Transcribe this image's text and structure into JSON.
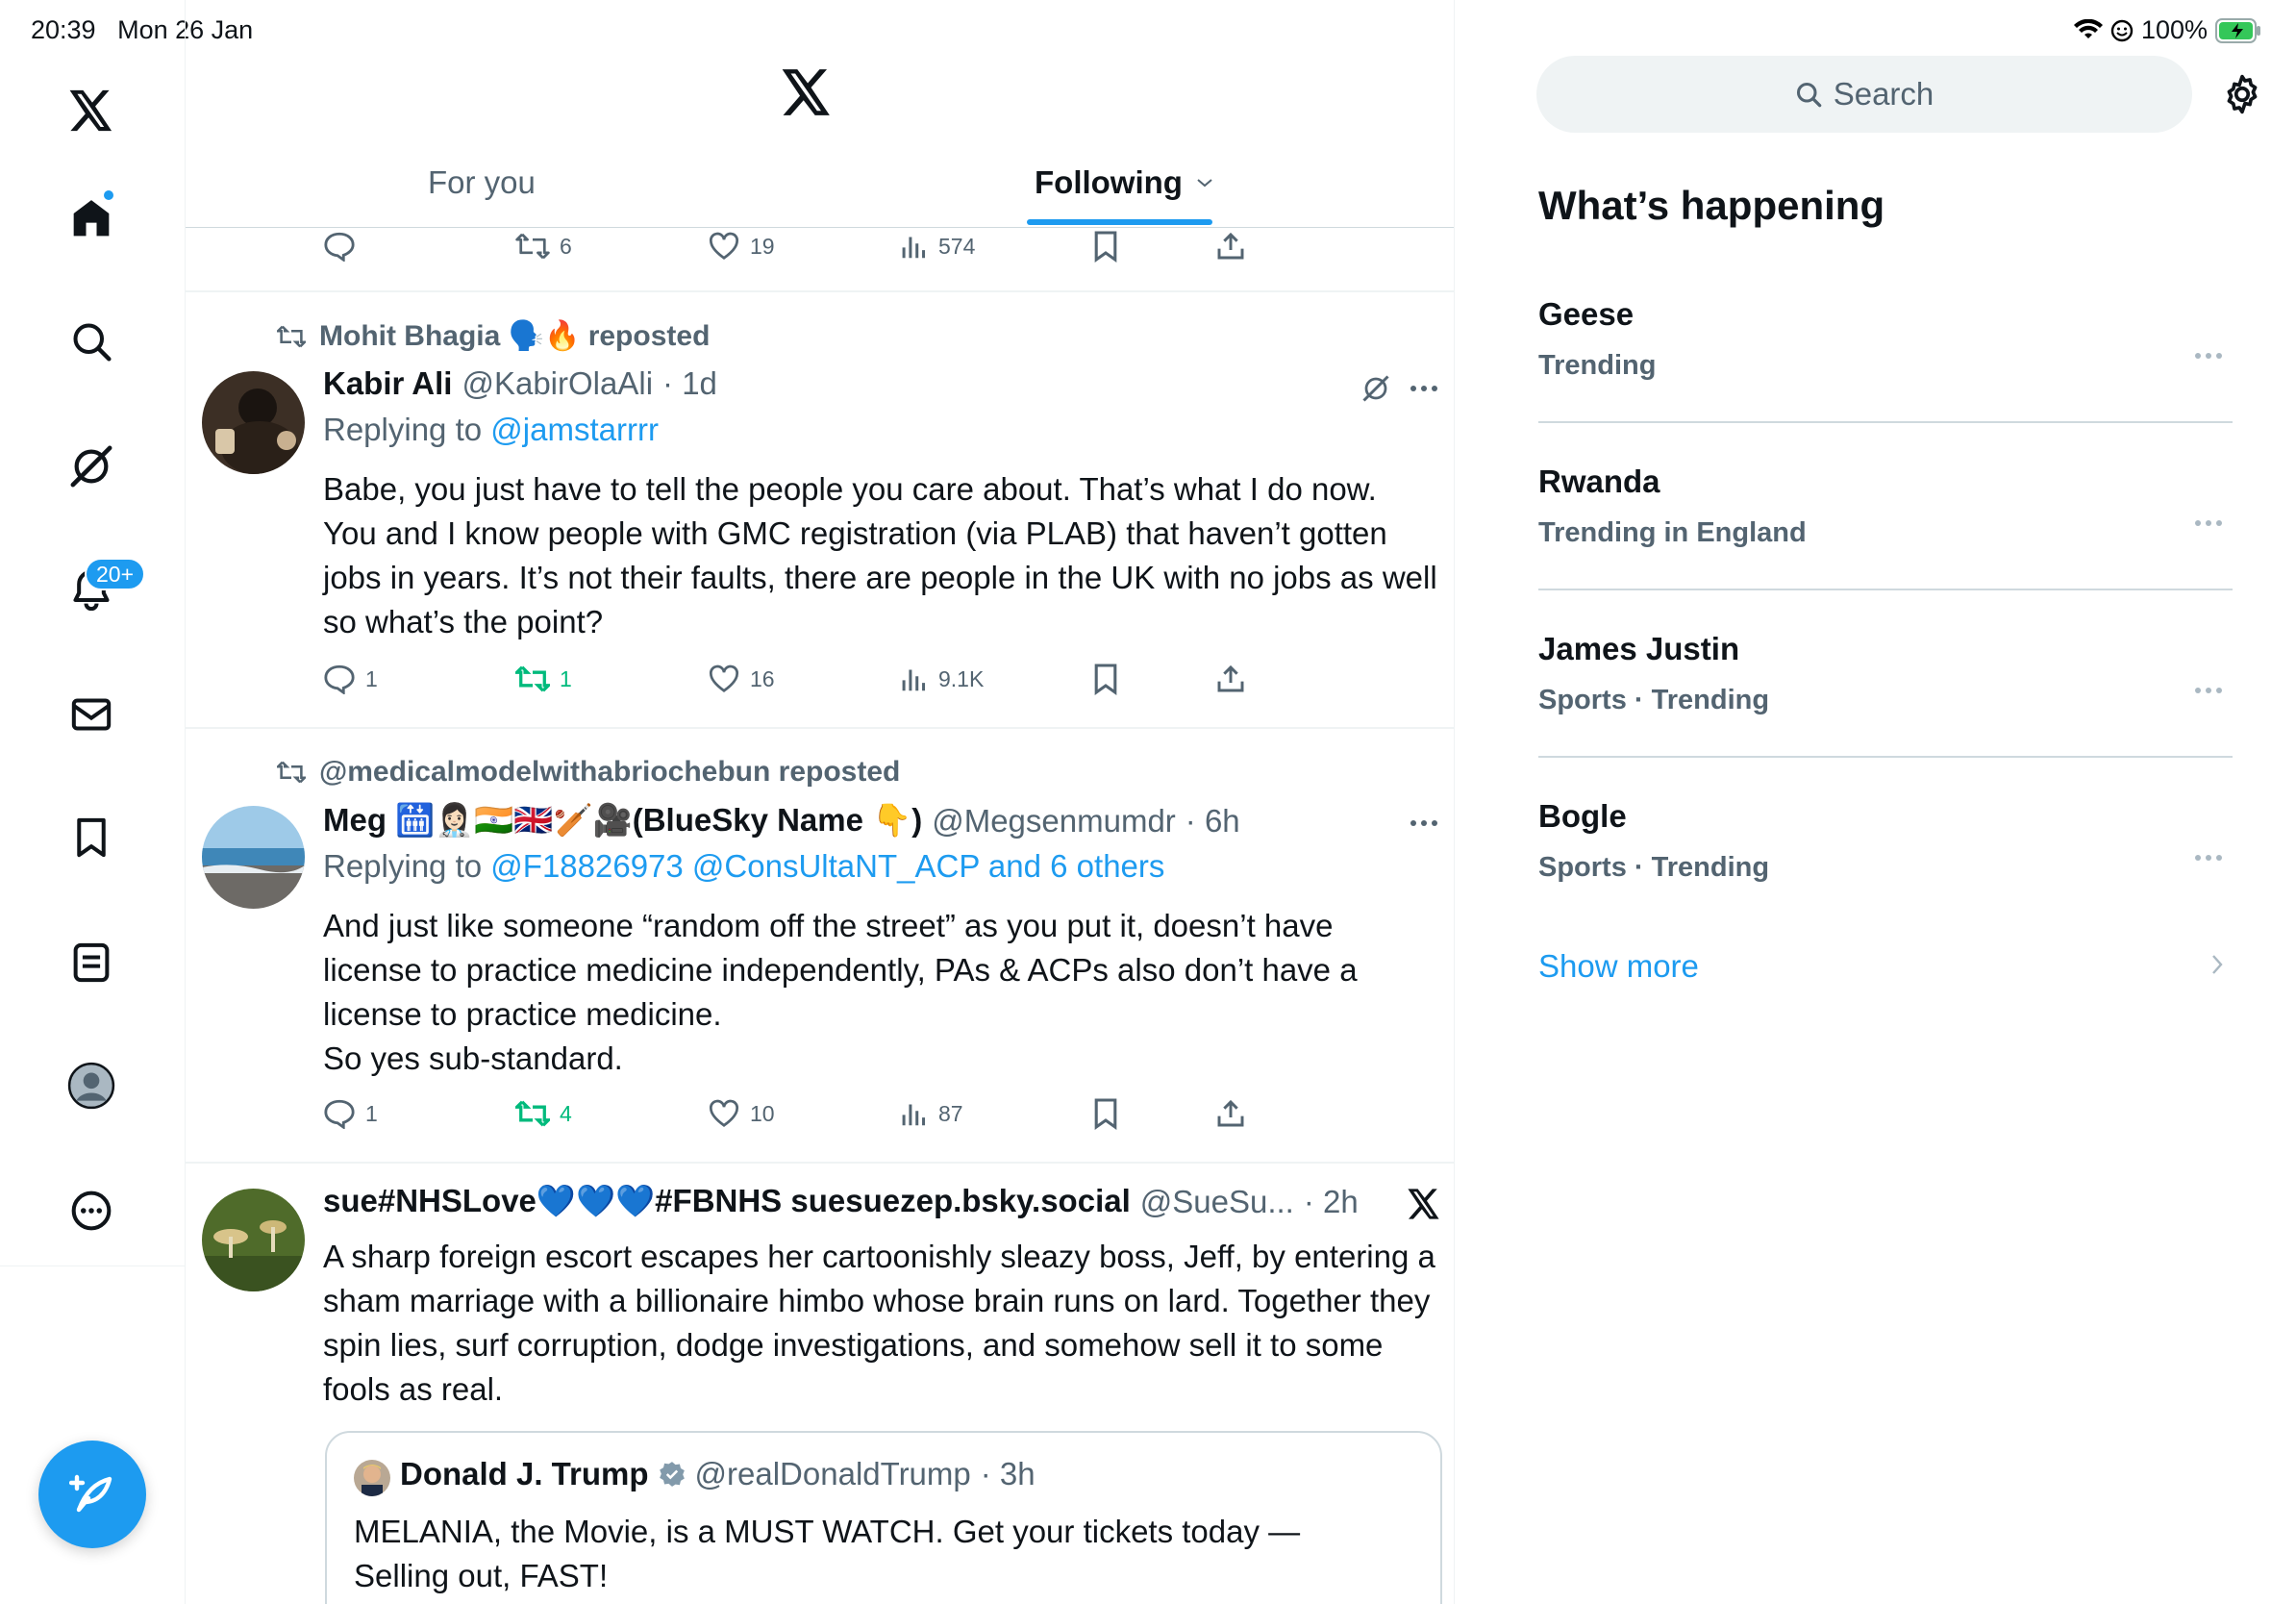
{
  "status_bar": {
    "time": "20:39",
    "date": "Mon 26 Jan",
    "battery": "100%"
  },
  "nav": {
    "items": [
      "home",
      "search",
      "grok",
      "notifications",
      "messages",
      "bookmarks",
      "lists",
      "profile",
      "more"
    ],
    "notifications_badge": "20+"
  },
  "header": {
    "tab_for_you": "For you",
    "tab_following": "Following"
  },
  "tweets": [
    {
      "reply_count": "",
      "repost_count": "6",
      "like_count": "19",
      "view_count": "574"
    },
    {
      "reposted_by": "Mohit Bhagia 🗣️🔥 reposted",
      "name": "Kabir Ali",
      "handle": "@KabirOlaAli",
      "time": "· 1d",
      "replying_label": "Replying to",
      "replying_to": "@jamstarrrr",
      "text": "Babe, you just have to tell the people you care about. That’s what I do now.\nYou and I know people with GMC registration (via PLAB) that haven’t gotten jobs in years. It’s not their faults, there are people in the UK with no jobs as well so what’s the point?",
      "reply_count": "1",
      "repost_count": "1",
      "like_count": "16",
      "view_count": "9.1K"
    },
    {
      "reposted_by": "@medicalmodelwithabriochebun reposted",
      "name": "Meg 🛗👩🏻‍⚕️🇮🇳🇬🇧🏏🎥(BlueSky Name 👇)",
      "handle": "@Megsenmumdr",
      "time": "· 6h",
      "replying_label": "Replying to",
      "replying_to": "@F18826973 @ConsUltaNT_ACP and 6 others",
      "text": "And just like someone “random off the street” as you put it, doesn’t have license to practice medicine independently, PAs & ACPs also don’t have a license to practice medicine.\nSo yes sub-standard.",
      "reply_count": "1",
      "repost_count": "4",
      "like_count": "10",
      "view_count": "87"
    },
    {
      "name": "sue#NHSLove💙💙💙#FBNHS suesuezep.bsky.social",
      "handle": "@SueSu...",
      "time": "· 2h",
      "text": "A sharp foreign escort escapes her cartoonishly sleazy boss, Jeff, by entering a sham marriage with a billionaire himbo whose brain runs on lard. Together they spin lies, surf corruption, dodge investigations, and somehow sell it to some fools as real.",
      "quote": {
        "name": "Donald J. Trump",
        "handle": "@realDonaldTrump",
        "time": "· 3h",
        "text": "MELANIA, the Movie, is a MUST WATCH. Get your tickets today —\nSelling out, FAST!"
      }
    }
  ],
  "sidebar": {
    "search_placeholder": "Search",
    "title": "What’s happening",
    "trends": [
      {
        "name": "Geese",
        "meta": "Trending"
      },
      {
        "name": "Rwanda",
        "meta": "Trending in England"
      },
      {
        "name": "James Justin",
        "meta": "Sports · Trending"
      },
      {
        "name": "Bogle",
        "meta": "Sports · Trending"
      }
    ],
    "show_more": "Show more"
  },
  "colors": {
    "accent": "#1d9bf0",
    "repost_green": "#00ba7c",
    "muted": "#536471"
  }
}
